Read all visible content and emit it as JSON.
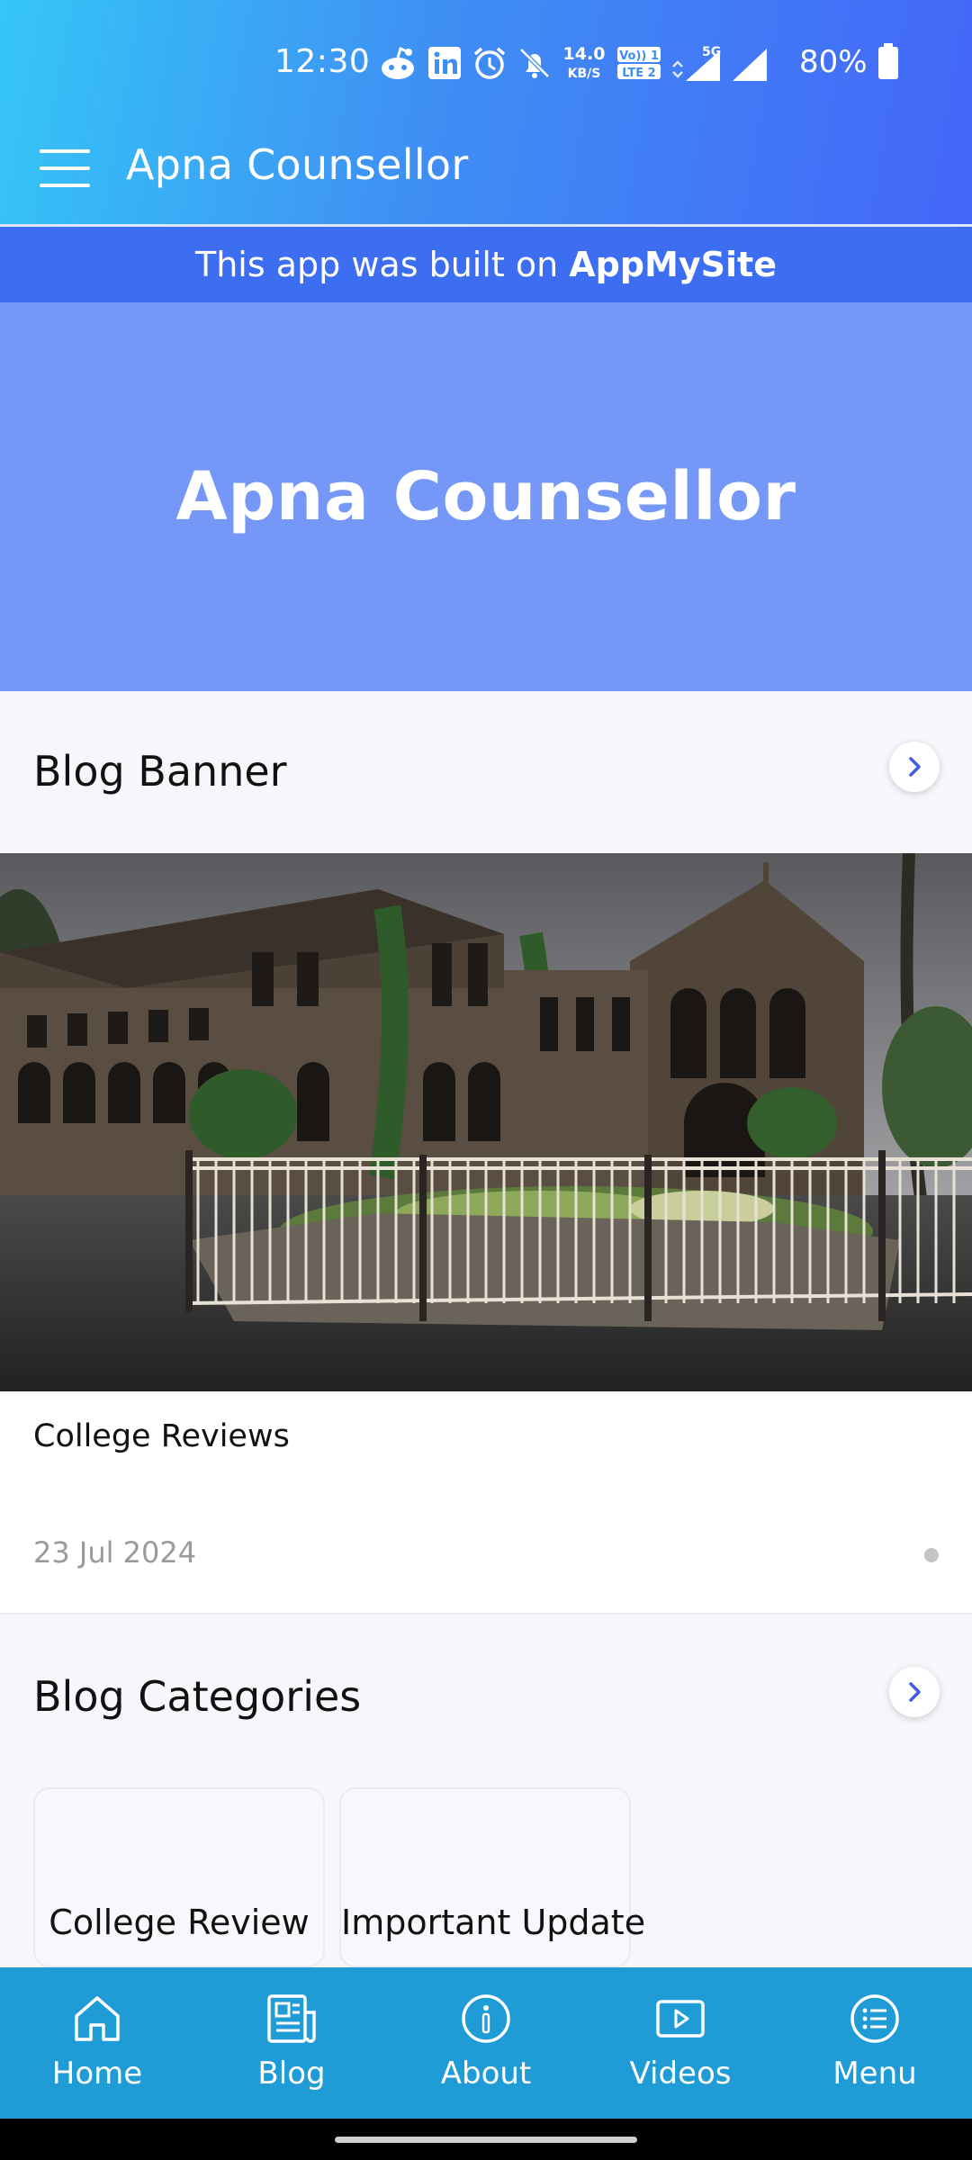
{
  "status_bar": {
    "time": "12:30",
    "net_speed_value": "14.0",
    "net_speed_unit": "KB/S",
    "volte_label_1": "Vo)) 1",
    "volte_label_2": "LTE 2",
    "network_type": "5G",
    "battery_percent": "80%",
    "icons": [
      "reddit-icon",
      "linkedin-icon",
      "alarm-icon",
      "bell-off-icon",
      "signal-icon",
      "signal-icon",
      "battery-icon"
    ]
  },
  "app_bar": {
    "title": "Apna Counsellor",
    "menu_icon": "hamburger-icon"
  },
  "built_banner": {
    "prefix": "This app was built on",
    "brand": "AppMySite"
  },
  "hero": {
    "title": "Apna Counsellor"
  },
  "blog_banner": {
    "title": "Blog Banner",
    "post": {
      "title": "College Reviews",
      "date": "23 Jul 2024"
    }
  },
  "blog_categories": {
    "title": "Blog Categories",
    "items": [
      {
        "label": "College Review"
      },
      {
        "label": "Important Update"
      }
    ]
  },
  "bottom_nav": {
    "items": [
      {
        "label": "Home",
        "icon": "home-icon"
      },
      {
        "label": "Blog",
        "icon": "blog-icon"
      },
      {
        "label": "About",
        "icon": "info-icon"
      },
      {
        "label": "Videos",
        "icon": "video-icon"
      },
      {
        "label": "Menu",
        "icon": "menu-list-icon"
      }
    ]
  },
  "colors": {
    "header_start": "#35c6f7",
    "header_end": "#4466f8",
    "built_bar": "#3d6ef2",
    "hero": "#7597f7",
    "bottom_nav": "#1f9bd6",
    "chevron": "#3d5fe0"
  }
}
